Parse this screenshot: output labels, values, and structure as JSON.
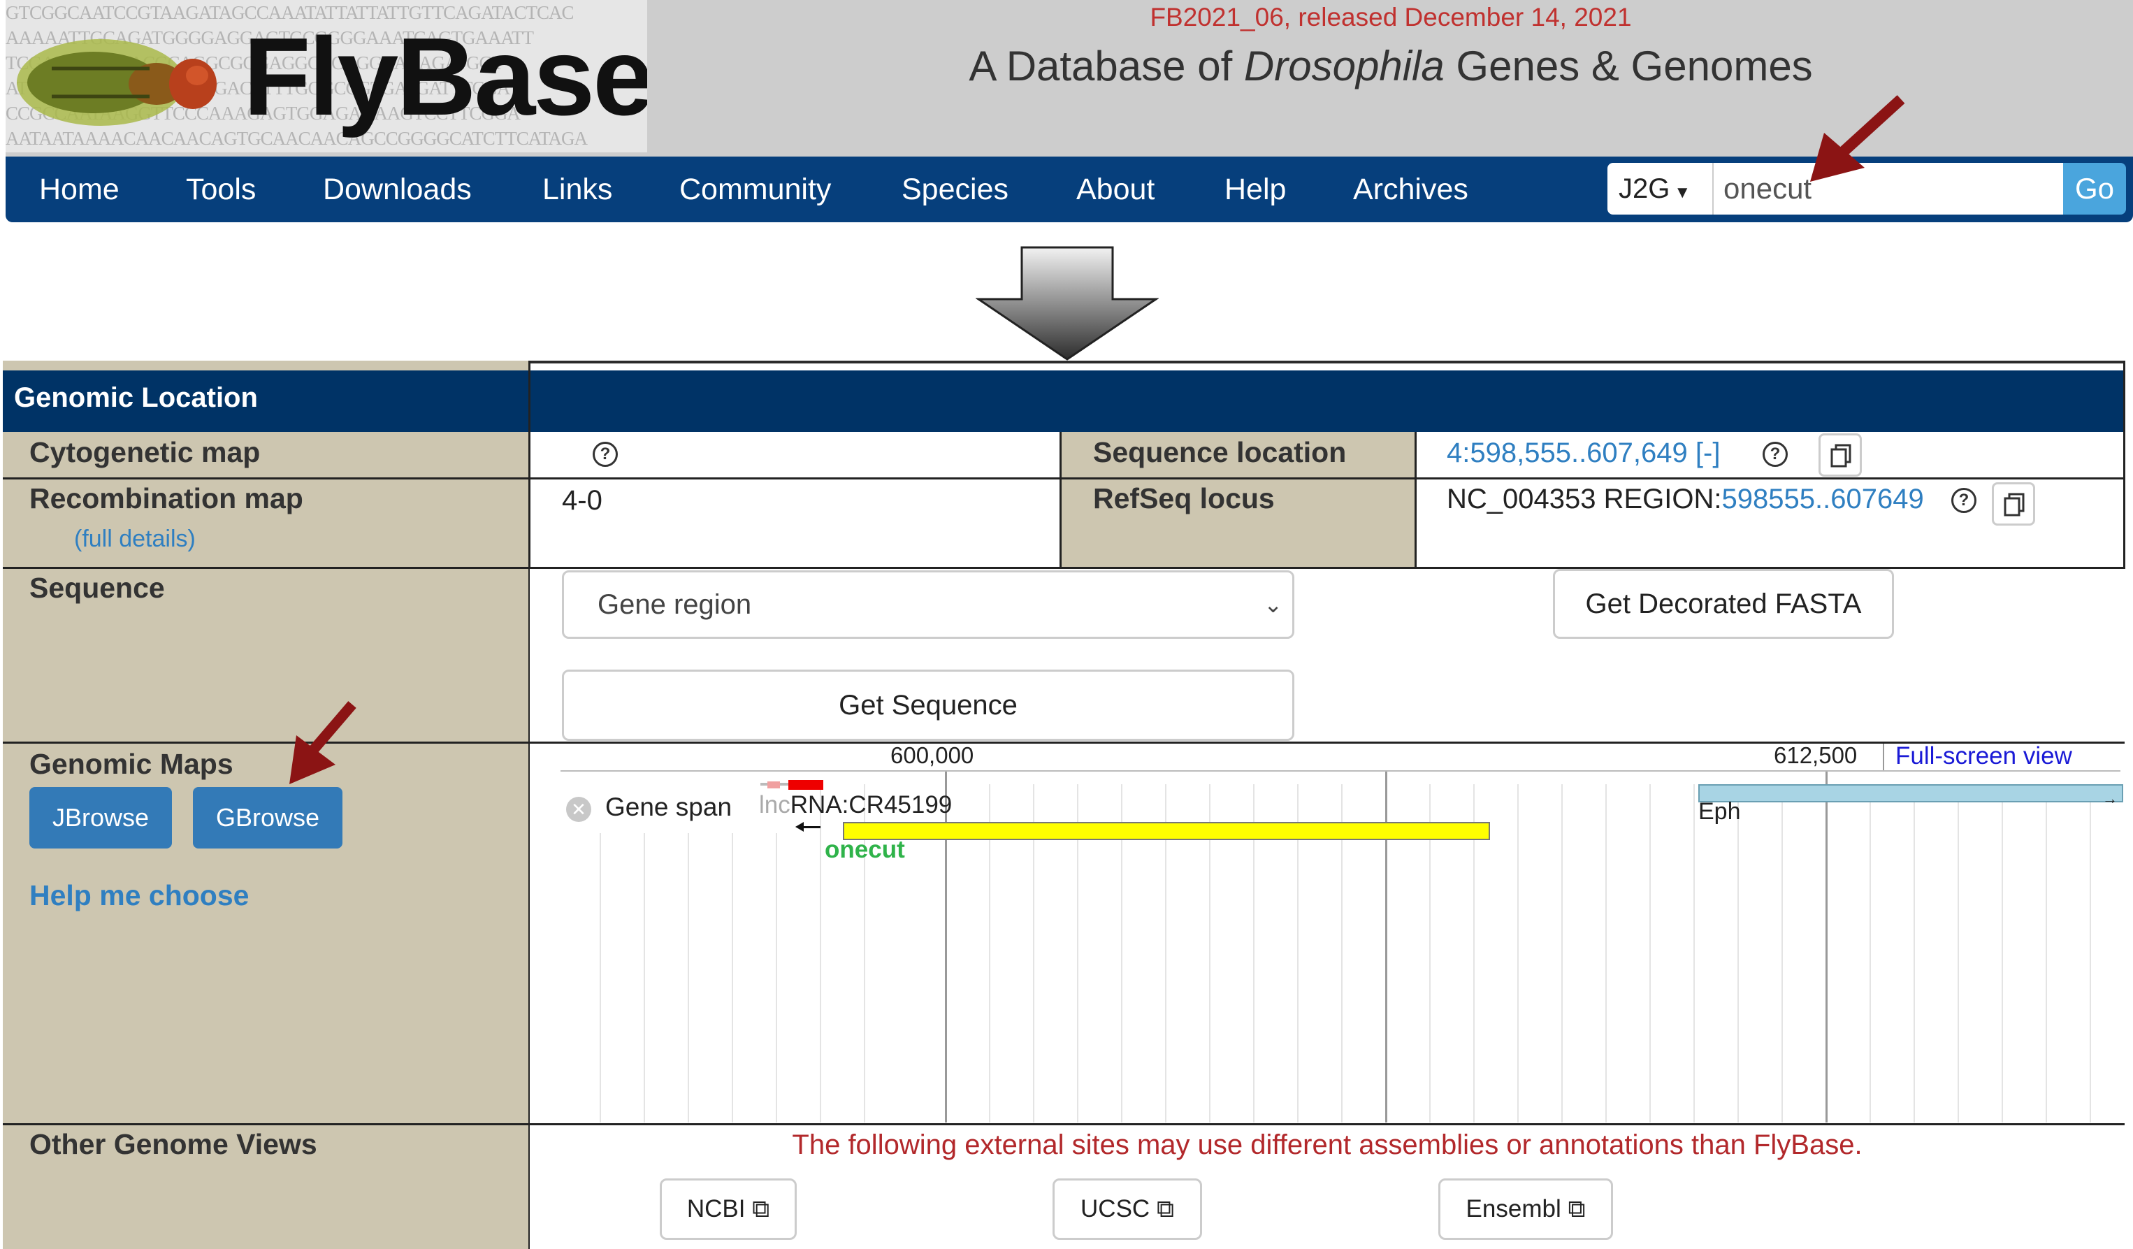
{
  "header": {
    "logo_text": "FlyBase",
    "release": "FB2021_06, released December 14, 2021",
    "tagline_pre": "A Database of ",
    "tagline_italic": "Drosophila",
    "tagline_post": " Genes & Genomes",
    "dna_lines": [
      "GTCGGCAATCCGTAAGATAGCCAAATATTATTATTGTTCAGATACTCAC",
      "AAAAATTGCAGATGGGGAGGAGTGCGGGGAAATCAGTGAAATT",
      "TCGAGGCGACACGCAGGCGGGAGGCCCAGGCACAGATGGT",
      "ATTTGTGGGAAAAGGCGGACTTTTGGGCCGTGATGATTTCGA",
      "CCGCCAATAAGGTTCCCAAAGAGTGGAGAGAAGTCCTTCGGA",
      "AATAATAAAACAACAACAGTGCAACAACAGCCGGGGCATCTTCATAGA"
    ]
  },
  "nav": {
    "items": [
      "Home",
      "Tools",
      "Downloads",
      "Links",
      "Community",
      "Species",
      "About",
      "Help",
      "Archives"
    ],
    "search_type": "J2G",
    "search_value": "onecut",
    "go_label": "Go"
  },
  "section": {
    "title": "Genomic Location",
    "cytogenetic_label": "Cytogenetic map",
    "sequence_location_label": "Sequence location",
    "sequence_location_value": "4:598,555..607,649",
    "sequence_location_toggle": "[-]",
    "recombination_label": "Recombination map",
    "full_details": "(full details)",
    "recombination_value": "4-0",
    "refseq_label": "RefSeq locus",
    "refseq_prefix": "NC_004353 REGION:",
    "refseq_link": "598555..607649",
    "sequence_label": "Sequence",
    "sequence_select": "Gene region",
    "decorated_fasta": "Get Decorated FASTA",
    "get_sequence": "Get Sequence",
    "genomic_maps_label": "Genomic Maps",
    "jbrowse": "JBrowse",
    "gbrowse": "GBrowse",
    "help_choose": "Help me choose",
    "other_views_label": "Other Genome Views",
    "external_warning": "The following external sites may use different assemblies or annotations than FlyBase.",
    "ncbi": "NCBI",
    "ucsc": "UCSC",
    "ensembl": "Ensembl"
  },
  "browser": {
    "tick_1": "600,000",
    "tick_2": "612,500",
    "full_screen": "Full-screen view",
    "gene_span": "Gene span",
    "lnc_prefix": "lnc",
    "lnc_name": "RNA:CR45199",
    "gene_name": "onecut",
    "eph_name": "Eph"
  },
  "colors": {
    "nav_bg": "#063f7c",
    "section_bg": "#003366",
    "label_bg": "#cdc6b0",
    "arrow_red": "#8b1414",
    "gene_yellow": "#ffff00",
    "gene_green": "#2fb34a",
    "eph_blue": "#a8d4e4",
    "warning_red": "#b2282b"
  }
}
